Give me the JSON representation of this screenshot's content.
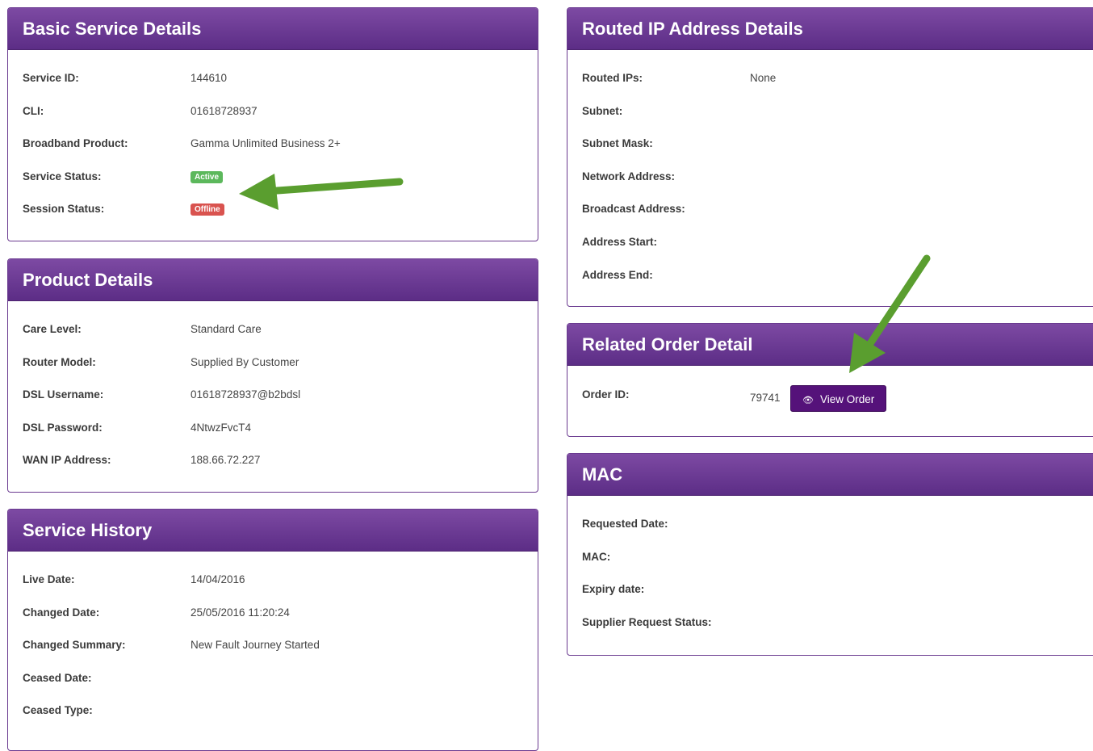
{
  "basic_service": {
    "title": "Basic Service Details",
    "rows": [
      {
        "label": "Service ID:",
        "value": "144610"
      },
      {
        "label": "CLI:",
        "value": "01618728937"
      },
      {
        "label": "Broadband Product:",
        "value": "Gamma Unlimited Business 2+"
      },
      {
        "label": "Service Status:",
        "badge": "Active"
      },
      {
        "label": "Session Status:",
        "badge": "Offline"
      }
    ]
  },
  "product_details": {
    "title": "Product Details",
    "rows": [
      {
        "label": "Care Level:",
        "value": "Standard Care"
      },
      {
        "label": "Router Model:",
        "value": "Supplied By Customer"
      },
      {
        "label": "DSL Username:",
        "value": "01618728937@b2bdsl"
      },
      {
        "label": "DSL Password:",
        "value": "4NtwzFvcT4"
      },
      {
        "label": "WAN IP Address:",
        "value": "188.66.72.227"
      }
    ]
  },
  "service_history": {
    "title": "Service History",
    "rows": [
      {
        "label": "Live Date:",
        "value": "14/04/2016"
      },
      {
        "label": "Changed Date:",
        "value": "25/05/2016 11:20:24"
      },
      {
        "label": "Changed Summary:",
        "value": "New Fault Journey Started"
      },
      {
        "label": "Ceased Date:",
        "value": ""
      },
      {
        "label": "Ceased Type:",
        "value": ""
      }
    ]
  },
  "routed_ip": {
    "title": "Routed IP Address Details",
    "rows": [
      {
        "label": "Routed IPs:",
        "value": "None"
      },
      {
        "label": "Subnet:",
        "value": ""
      },
      {
        "label": "Subnet Mask:",
        "value": ""
      },
      {
        "label": "Network Address:",
        "value": ""
      },
      {
        "label": "Broadcast Address:",
        "value": ""
      },
      {
        "label": "Address Start:",
        "value": ""
      },
      {
        "label": "Address End:",
        "value": ""
      }
    ]
  },
  "related_order": {
    "title": "Related Order Detail",
    "label": "Order ID:",
    "value": "79741",
    "button_label": "View Order"
  },
  "mac": {
    "title": "MAC",
    "rows": [
      {
        "label": "Requested Date:",
        "value": ""
      },
      {
        "label": "MAC:",
        "value": ""
      },
      {
        "label": "Expiry date:",
        "value": ""
      },
      {
        "label": "Supplier Request Status:",
        "value": ""
      }
    ]
  },
  "colors": {
    "header": "#5c2d86",
    "active_badge": "#5cb85c",
    "offline_badge": "#d9534f",
    "button": "#55127a",
    "annotation_arrow": "#5a9e2f"
  }
}
